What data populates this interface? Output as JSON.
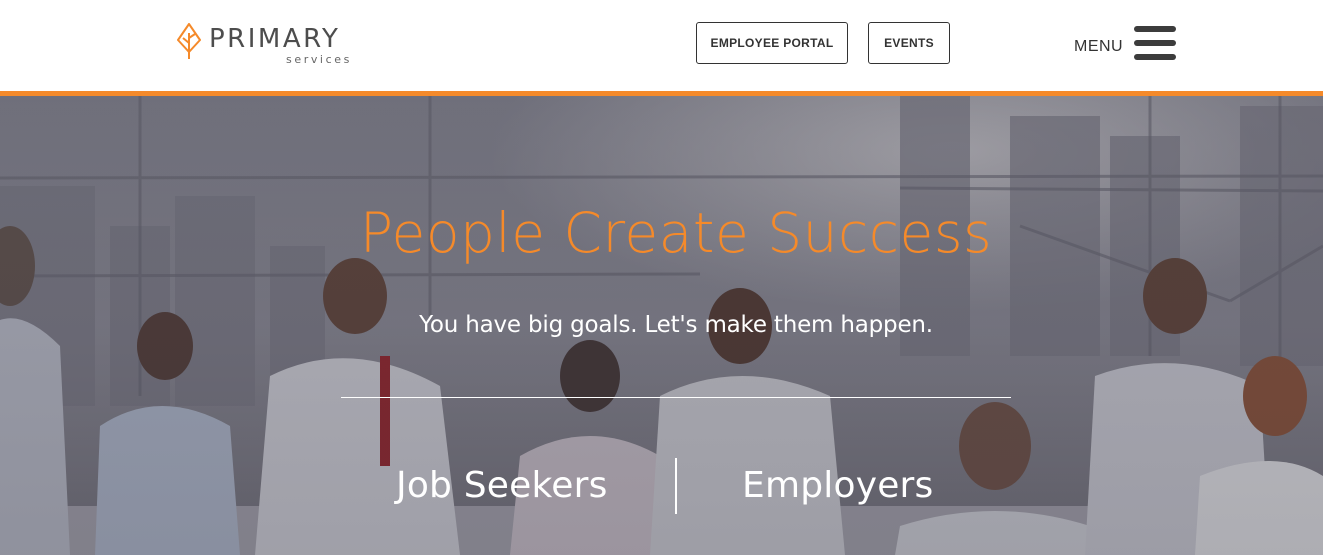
{
  "header": {
    "logo": {
      "word": "PRIMARY",
      "sub": "services",
      "icon": "diamond-leaf-logo"
    },
    "buttons": {
      "employee_portal": "EMPLOYEE PORTAL",
      "events": "EVENTS"
    },
    "menu_label": "MENU",
    "menu_icon": "hamburger-icon"
  },
  "hero": {
    "title": "People Create Success",
    "subtitle": "You have big goals. Let's make them happen.",
    "links": {
      "job_seekers": "Job Seekers",
      "employers": "Employers"
    },
    "background": "office-meeting-photo"
  },
  "colors": {
    "accent": "#f58a2a",
    "text_dark": "#333333",
    "hero_text": "#ffffff"
  }
}
